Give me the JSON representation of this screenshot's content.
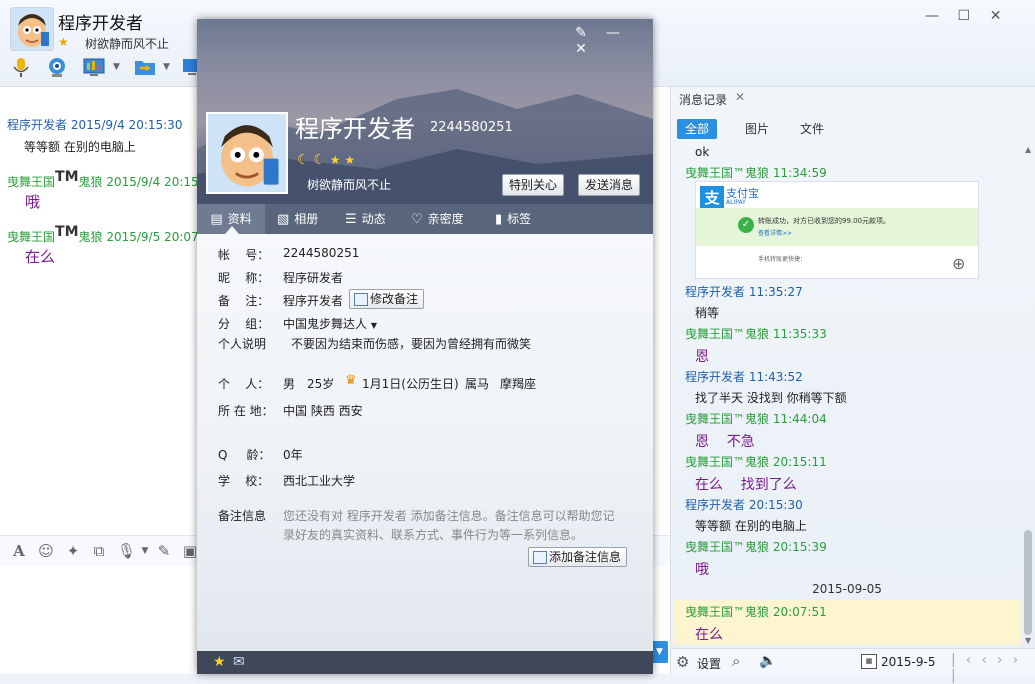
{
  "chat": {
    "name": "程序开发者",
    "signature": "树欲静而风不止",
    "window_controls": {
      "minimize": "—",
      "maximize": "☐",
      "close": "✕"
    }
  },
  "messages": [
    {
      "sender": "程序开发者",
      "time": "2015/9/4 20:15:30",
      "text": "等等额  在别的电脑上"
    },
    {
      "sender_a": "曳舞王国",
      "tm": "TM",
      "sender_b": "鬼狼",
      "time": "2015/9/4 20:15",
      "text": "哦"
    },
    {
      "sender_a": "曳舞王国",
      "tm": "TM",
      "sender_b": "鬼狼",
      "time": "2015/9/5 20:07",
      "text": "在么"
    }
  ],
  "history": {
    "tab_label": "消息记录",
    "close": "✕",
    "filters": {
      "all": "全部",
      "images": "图片",
      "files": "文件"
    },
    "entries": [
      {
        "head": "",
        "body": "ok"
      },
      {
        "head": "曳舞王国™鬼狼 11:34:59",
        "body": ""
      },
      {
        "head": "程序开发者 11:35:27",
        "body": "稍等"
      },
      {
        "head": "曳舞王国™鬼狼 11:35:33",
        "body": "恩"
      },
      {
        "head": "程序开发者 11:43:52",
        "body": "找了半天 没找到 你稍等下额"
      },
      {
        "head": "曳舞王国™鬼狼 11:44:04",
        "body": "恩    不急"
      },
      {
        "head": "曳舞王国™鬼狼 20:15:11",
        "body": "在么    找到了么"
      },
      {
        "head": "程序开发者 20:15:30",
        "body": "等等额  在别的电脑上"
      },
      {
        "head": "曳舞王国™鬼狼 20:15:39",
        "body": "哦"
      },
      {
        "head": "曳舞王国™鬼狼 20:07:51",
        "body": "在么"
      }
    ],
    "date_divider": "2015-09-05",
    "alipay": {
      "brand": "支付宝",
      "brand_en": "ALIPAY",
      "success": "转账成功，对方已收到您的99.00元款项。",
      "link": "查看详情>>",
      "hint": "手机转账更快捷："
    },
    "footer": {
      "settings": "设置",
      "date": "2015-9-5"
    }
  },
  "profile": {
    "name": "程序开发者",
    "qq": "2244580251",
    "signature": "树欲静而风不止",
    "buttons": {
      "care": "特别关心",
      "send": "发送消息"
    },
    "tabs": [
      "资料",
      "相册",
      "动态",
      "亲密度",
      "标签"
    ],
    "fields": {
      "account_label": "帐    号：",
      "account": "2244580251",
      "nick_label": "昵    称：",
      "nick": "程序研发者",
      "remark_label": "备    注：",
      "remark": "程序开发者",
      "edit_remark": "修改备注",
      "group_label": "分    组：",
      "group": "中国鬼步舞达人",
      "desc_label": "个人说明",
      "desc": "不要因为结束而伤感，要因为曾经拥有而微笑",
      "person_label": "个    人：",
      "gender": "男",
      "age": "25岁",
      "birthday": "1月1日(公历生日)",
      "zodiac": "属马",
      "constellation": "摩羯座",
      "location_label": "所 在 地：",
      "location": "中国 陕西 西安",
      "qage_label": "Q     龄：",
      "qage": "0年",
      "school_label": "学    校：",
      "school": "西北工业大学",
      "note_label": "备注信息",
      "note_line1": "您还没有对 程序开发者 添加备注信息。备注信息可以帮助您记",
      "note_line2": "录好友的真实资料、联系方式、事件行为等一系列信息。",
      "add_note": "添加备注信息"
    }
  },
  "colors": {
    "accent": "#2c8fe0",
    "green_name": "#2a9d3b",
    "blue_name": "#1f5fae",
    "purple_text": "#7a1b8f"
  }
}
